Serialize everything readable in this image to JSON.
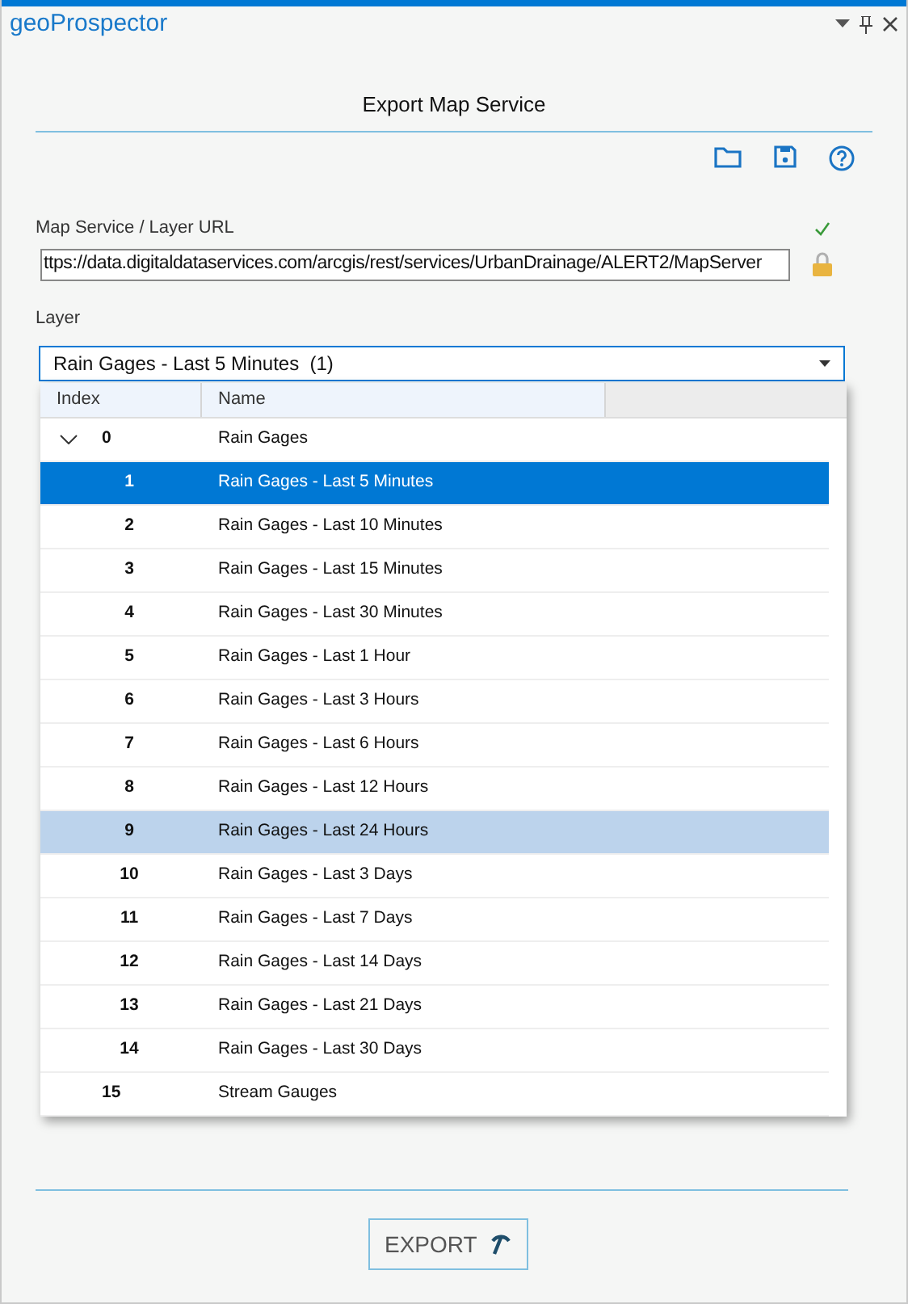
{
  "panel": {
    "title": "geoProspector"
  },
  "heading": "Export Map Service",
  "url": {
    "label": "Map Service / Layer URL",
    "valid": true,
    "value": "ttps://data.digitaldataservices.com/arcgis/rest/services/UrbanDrainage/ALERT2/MapServer",
    "locked": true
  },
  "layer": {
    "label": "Layer",
    "value": "Rain Gages - Last 5 Minutes  (1)",
    "open": true,
    "columns": [
      "Index",
      "Name"
    ],
    "rows": [
      {
        "index": "0",
        "name": "Rain Gages",
        "selected": false,
        "hovered": false,
        "expanded": true,
        "children": [
          {
            "index": "1",
            "name": "Rain Gages - Last 5 Minutes",
            "selected": true,
            "hovered": false
          },
          {
            "index": "2",
            "name": "Rain Gages - Last 10 Minutes",
            "selected": false,
            "hovered": false
          },
          {
            "index": "3",
            "name": "Rain Gages - Last 15 Minutes",
            "selected": false,
            "hovered": false
          },
          {
            "index": "4",
            "name": "Rain Gages - Last 30 Minutes",
            "selected": false,
            "hovered": false
          },
          {
            "index": "5",
            "name": "Rain Gages - Last 1 Hour",
            "selected": false,
            "hovered": false
          },
          {
            "index": "6",
            "name": "Rain Gages - Last 3 Hours",
            "selected": false,
            "hovered": false
          },
          {
            "index": "7",
            "name": "Rain Gages - Last 6 Hours",
            "selected": false,
            "hovered": false
          },
          {
            "index": "8",
            "name": "Rain Gages - Last 12 Hours",
            "selected": false,
            "hovered": false
          },
          {
            "index": "9",
            "name": "Rain Gages - Last 24 Hours",
            "selected": false,
            "hovered": true
          },
          {
            "index": "10",
            "name": "Rain Gages - Last 3 Days",
            "selected": false,
            "hovered": false
          },
          {
            "index": "11",
            "name": "Rain Gages - Last 7 Days",
            "selected": false,
            "hovered": false
          },
          {
            "index": "12",
            "name": "Rain Gages - Last 14 Days",
            "selected": false,
            "hovered": false
          },
          {
            "index": "13",
            "name": "Rain Gages - Last 21 Days",
            "selected": false,
            "hovered": false
          },
          {
            "index": "14",
            "name": "Rain Gages - Last 30 Days",
            "selected": false,
            "hovered": false
          }
        ]
      },
      {
        "index": "15",
        "name": "Stream Gauges",
        "selected": false,
        "hovered": false
      }
    ]
  },
  "export_button": "EXPORT"
}
